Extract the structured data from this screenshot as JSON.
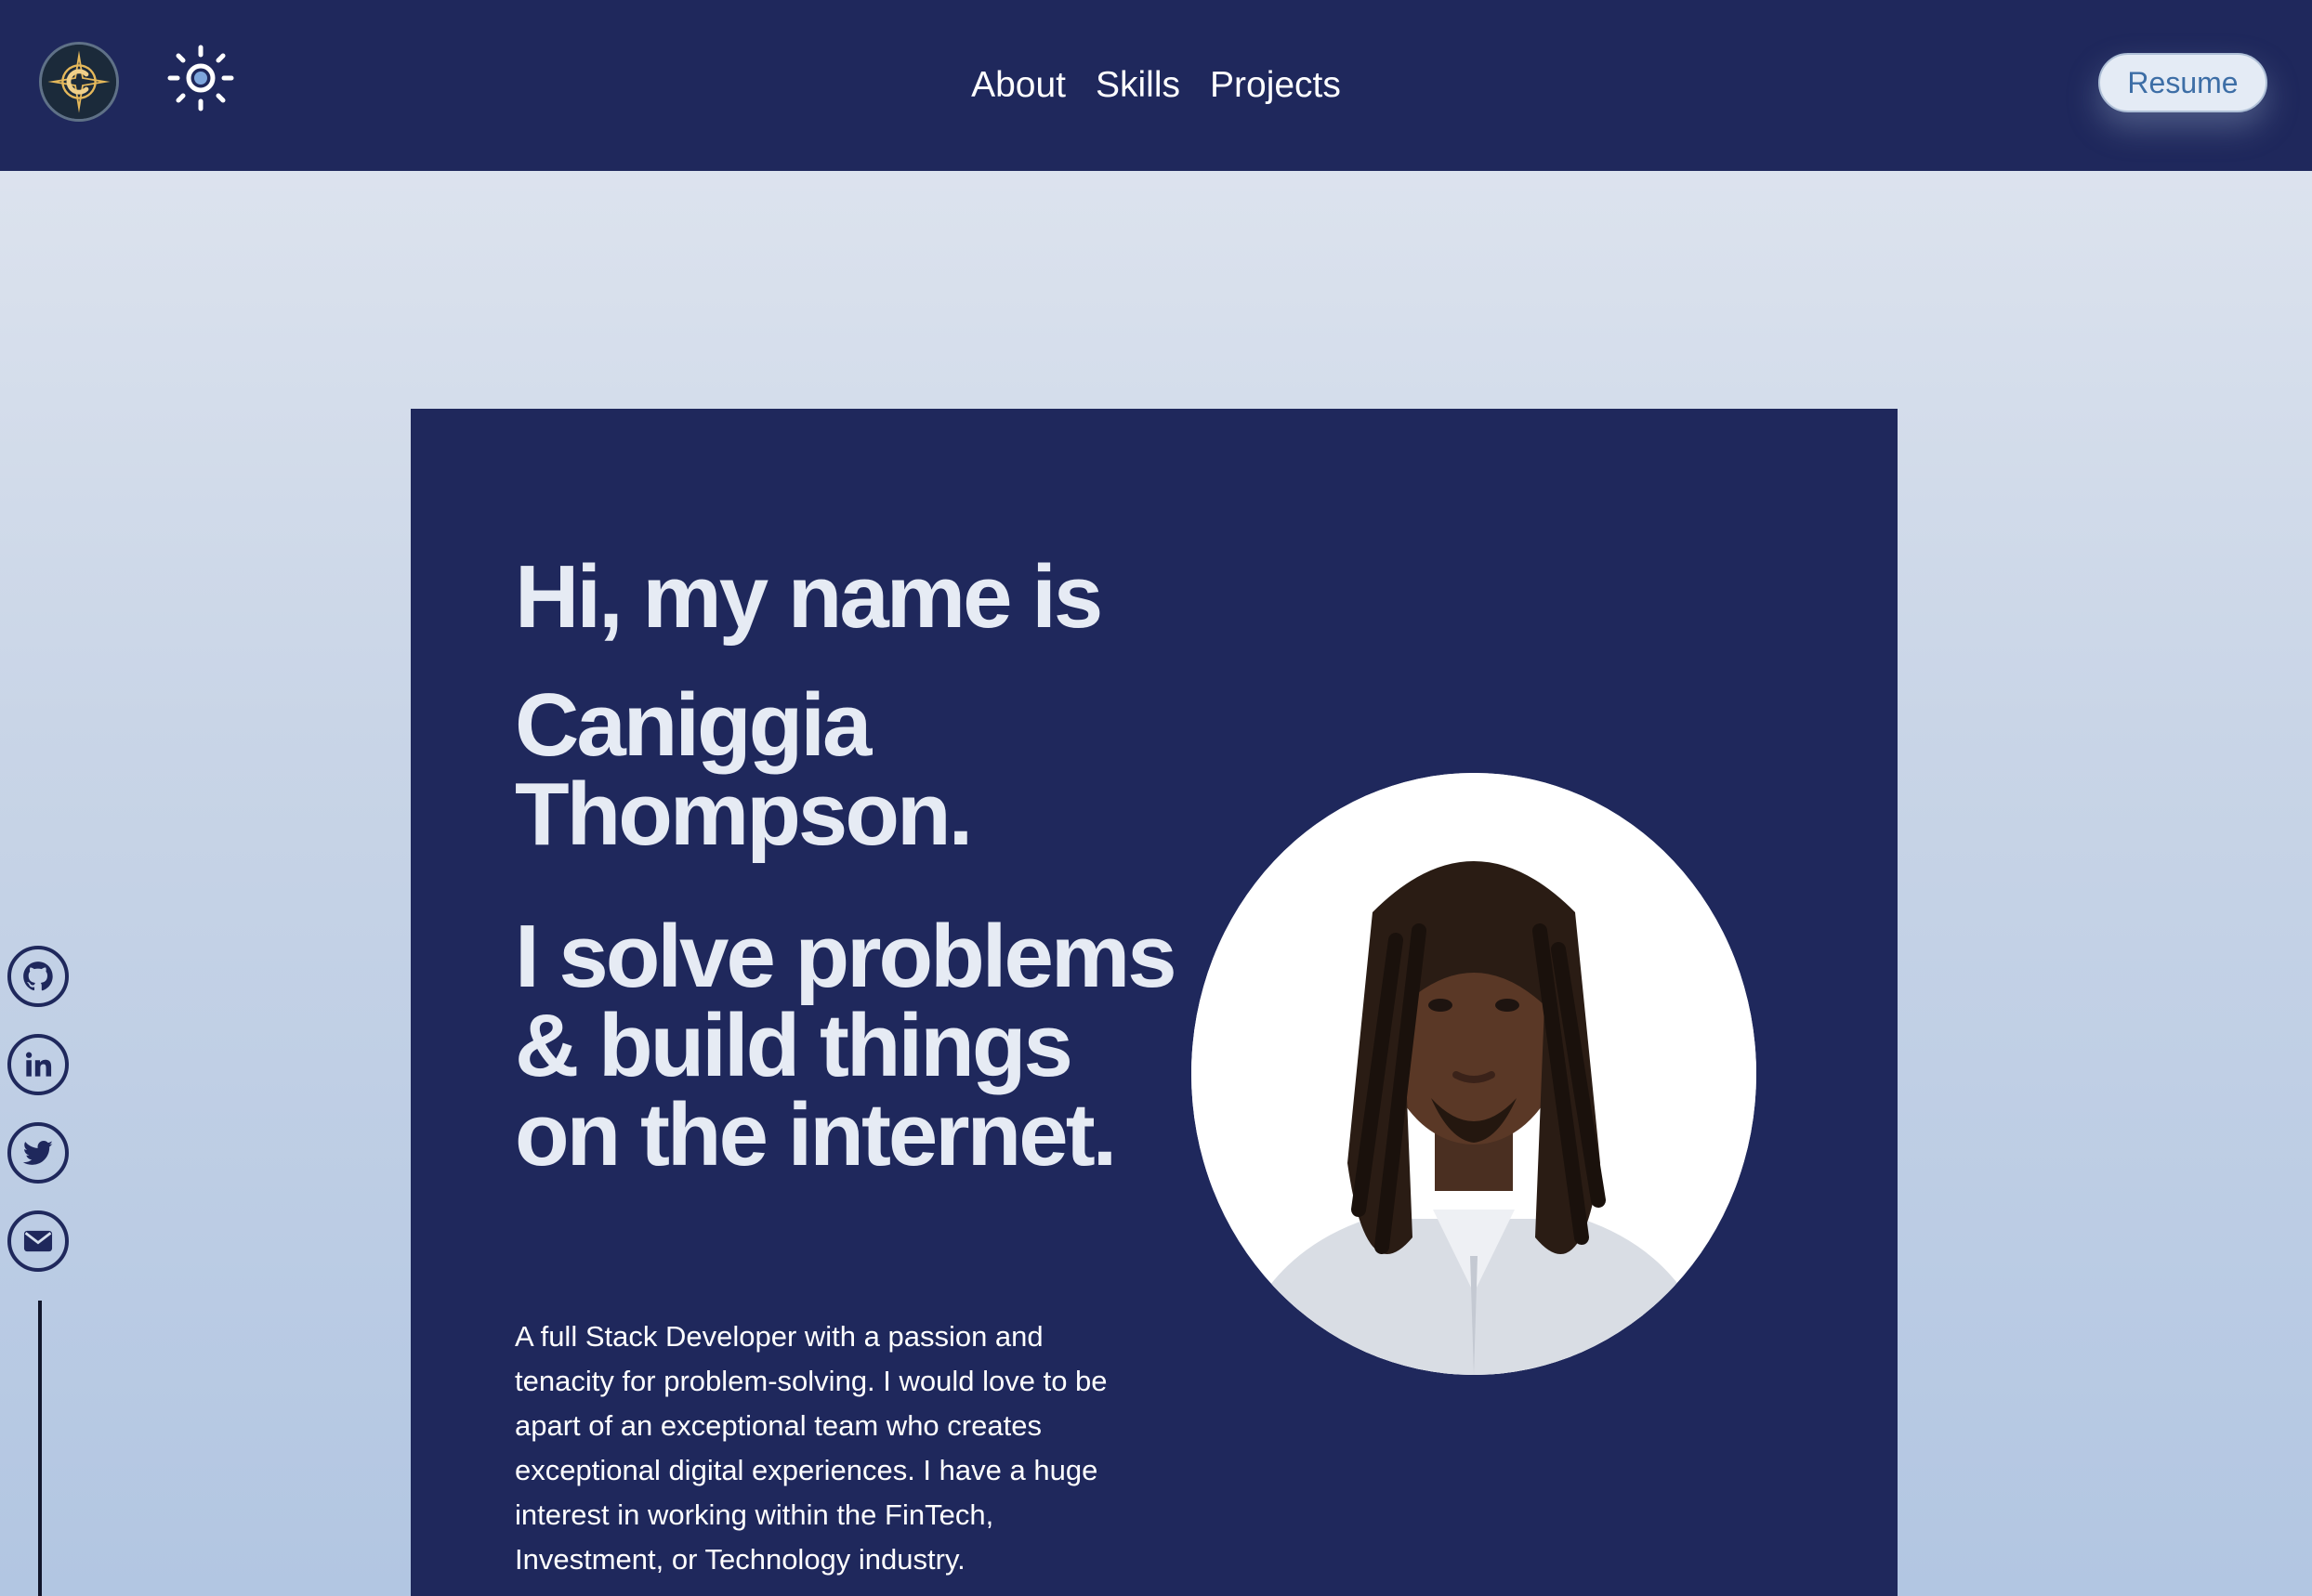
{
  "nav": {
    "links": [
      "About",
      "Skills",
      "Projects"
    ],
    "resume_label": "Resume"
  },
  "icons": {
    "logo": "compass-c-logo",
    "theme_toggle": "sun-icon",
    "social": [
      "github-icon",
      "linkedin-icon",
      "twitter-icon",
      "email-icon"
    ]
  },
  "hero": {
    "greeting": "Hi, my name is",
    "name": "Caniggia Thompson.",
    "tagline": "I solve problems & build things on the internet.",
    "bio": "A full Stack Developer with a passion and tenacity for problem-solving. I would love to be apart of an exceptional team who creates exceptional digital experiences. I have a huge interest in working within the FinTech, Investment, or Technology industry."
  },
  "colors": {
    "navbar_bg": "#1f285c",
    "hero_bg": "#1f285c",
    "heading_text": "#e6ebf4",
    "resume_text": "#3d6ea6"
  }
}
